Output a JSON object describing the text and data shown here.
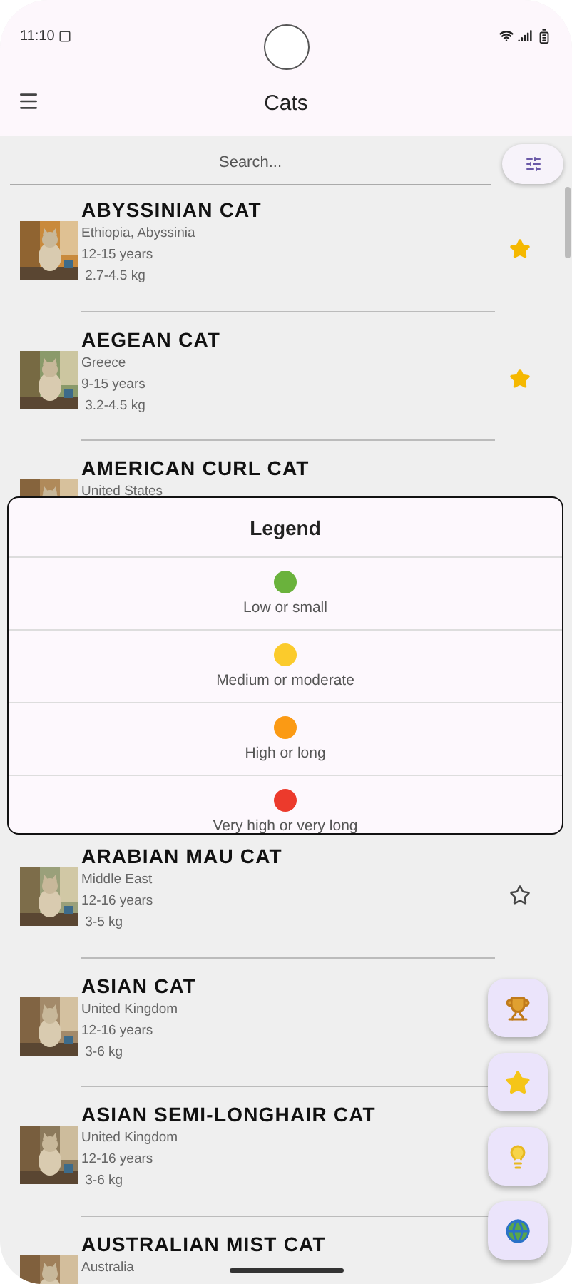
{
  "status_bar": {
    "time": "11:10"
  },
  "app_bar": {
    "title": "Cats"
  },
  "search": {
    "placeholder": "Search..."
  },
  "cats": [
    {
      "name": "ABYSSINIAN CAT",
      "origin": "Ethiopia, Abyssinia",
      "lifespan": "12-15 years",
      "weight": " 2.7-4.5 kg",
      "favorite": true
    },
    {
      "name": "AEGEAN CAT",
      "origin": "Greece",
      "lifespan": "9-15 years",
      "weight": " 3.2-4.5 kg",
      "favorite": true
    },
    {
      "name": "AMERICAN CURL CAT",
      "origin": "United States"
    },
    {
      "name": "ARABIAN MAU CAT",
      "origin": "Middle East",
      "lifespan": "12-16 years",
      "weight": " 3-5 kg",
      "favorite": false
    },
    {
      "name": "ASIAN CAT",
      "origin": "United Kingdom",
      "lifespan": "12-16 years",
      "weight": " 3-6 kg"
    },
    {
      "name": "ASIAN SEMI-LONGHAIR CAT",
      "origin": "United Kingdom",
      "lifespan": "12-16 years",
      "weight": " 3-6 kg"
    },
    {
      "name": "AUSTRALIAN MIST CAT",
      "origin": "Australia"
    }
  ],
  "legend": {
    "title": "Legend",
    "items": [
      {
        "label": "Low or small",
        "color": "#6ab23c"
      },
      {
        "label": "Medium or moderate",
        "color": "#fbcb2c"
      },
      {
        "label": "High or long",
        "color": "#fb9a14"
      },
      {
        "label": "Very high or very long",
        "color": "#ec3a2c"
      }
    ]
  },
  "fabs": [
    {
      "kind": "trophy"
    },
    {
      "kind": "star"
    },
    {
      "kind": "idea"
    },
    {
      "kind": "globe"
    }
  ]
}
